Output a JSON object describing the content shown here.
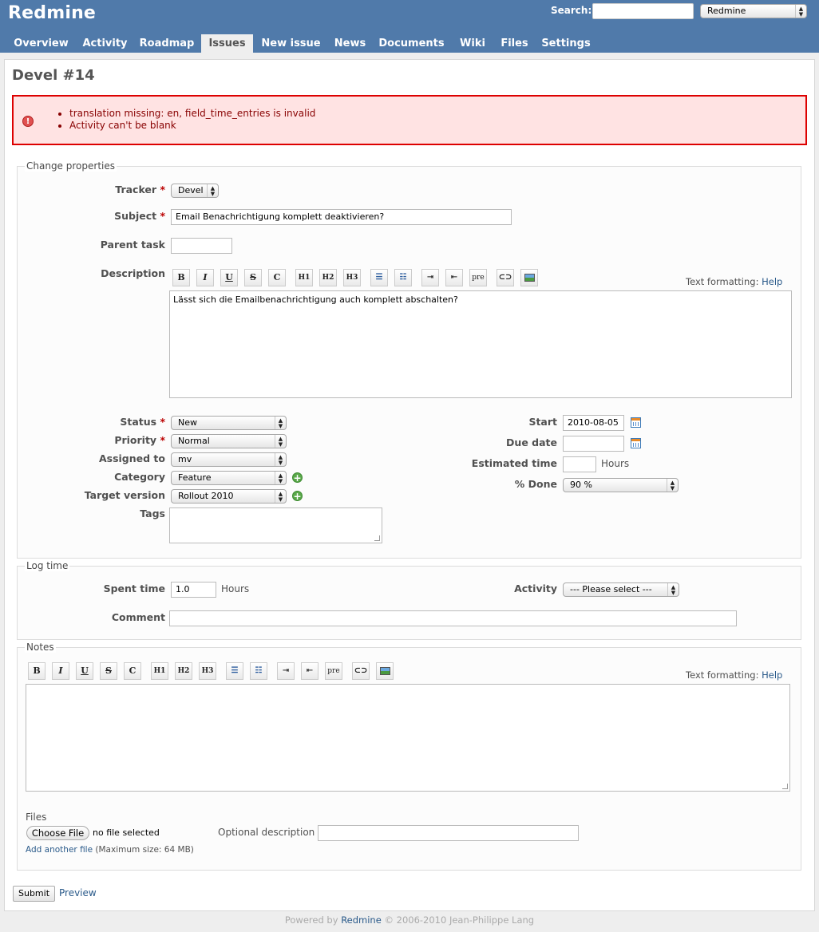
{
  "header": {
    "app_title": "Redmine",
    "search_label": "Search:",
    "project_select": "Redmine",
    "tabs": [
      "Overview",
      "Activity",
      "Roadmap",
      "Issues",
      "New issue",
      "News",
      "Documents",
      "Wiki",
      "Files",
      "Settings"
    ],
    "selected_tab": "Issues"
  },
  "page_title": "Devel #14",
  "errors": [
    "translation missing: en, field_time_entries is invalid",
    "Activity can't be blank"
  ],
  "properties": {
    "legend": "Change properties",
    "tracker_label": "Tracker",
    "tracker_value": "Devel",
    "subject_label": "Subject",
    "subject_value": "Email Benachrichtigung komplett deaktivieren?",
    "parent_label": "Parent task",
    "description_label": "Description",
    "text_formatting": "Text formatting:",
    "help_link": "Help",
    "description_value": "Lässt sich die Emailbenachrichtigung auch komplett abschalten?",
    "status_label": "Status",
    "status_value": "New",
    "priority_label": "Priority",
    "priority_value": "Normal",
    "assigned_label": "Assigned to",
    "assigned_value": "mv",
    "category_label": "Category",
    "category_value": "Feature",
    "target_label": "Target version",
    "target_value": "Rollout 2010",
    "tags_label": "Tags",
    "start_label": "Start",
    "start_value": "2010-08-05",
    "due_label": "Due date",
    "estimated_label": "Estimated time",
    "hours": "Hours",
    "done_label": "% Done",
    "done_value": "90 %"
  },
  "toolbar": {
    "bold": "B",
    "italic": "I",
    "underline": "U",
    "strike": "S",
    "code": "C",
    "h1": "H1",
    "h2": "H2",
    "h3": "H3",
    "pre": "pre"
  },
  "log_time": {
    "legend": "Log time",
    "spent_label": "Spent time",
    "spent_value": "1.0",
    "hours": "Hours",
    "activity_label": "Activity",
    "activity_value": "--- Please select ---",
    "comment_label": "Comment"
  },
  "notes": {
    "legend": "Notes",
    "text_formatting": "Text formatting:",
    "help_link": "Help",
    "files_label": "Files",
    "choose_file": "Choose File",
    "no_file": "no file selected",
    "optional_description": "Optional description",
    "add_another": "Add another file",
    "max_size": "(Maximum size: 64 MB)"
  },
  "actions": {
    "submit": "Submit",
    "preview": "Preview"
  },
  "footer": {
    "powered_by": "Powered by",
    "redmine": "Redmine",
    "copyright": "© 2006-2010 Jean-Philippe Lang"
  },
  "colors": {
    "header": "#507aaa",
    "error_border": "#dd0000",
    "error_bg": "#ffe3e3",
    "link": "#2a5a8a"
  }
}
